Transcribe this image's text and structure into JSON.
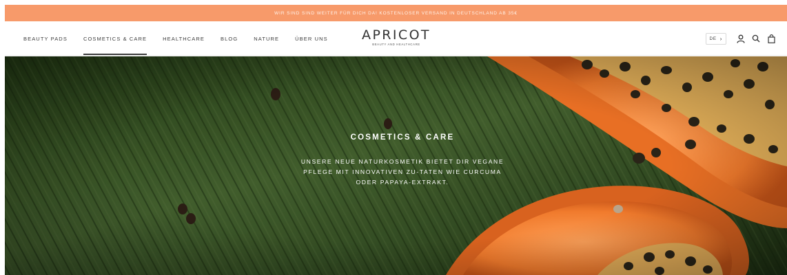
{
  "announcement": {
    "text": "WIR SIND SIND WEITER FÜR DICH DA! KOSTENLOSER VERSAND IN DEUTSCHLAND AB 35€"
  },
  "nav": {
    "items": [
      {
        "label": "BEAUTY PADS",
        "active": false
      },
      {
        "label": "COSMETICS & CARE",
        "active": true
      },
      {
        "label": "HEALTHCARE",
        "active": false
      },
      {
        "label": "BLOG",
        "active": false
      },
      {
        "label": "NATURE",
        "active": false
      },
      {
        "label": "ÜBER UNS",
        "active": false
      }
    ]
  },
  "logo": {
    "word": "APRICOT",
    "tagline": "BEAUTY AND HEALTHCARE"
  },
  "header_right": {
    "language": "DE",
    "icons": [
      "user-icon",
      "search-icon",
      "bag-icon"
    ]
  },
  "hero": {
    "title": "COSMETICS & CARE",
    "body": "UNSERE NEUE NATURKOSMETIK BIETET DIR VEGANE PFLEGE MIT INNOVATIVEN ZU-TATEN WIE CURCUMA ODER PAPAYA-EXTRAKT."
  },
  "colors": {
    "announcement_bg": "#f79a6a",
    "leaf_green": "#3c5a2a",
    "papaya_orange": "#f0782a"
  }
}
